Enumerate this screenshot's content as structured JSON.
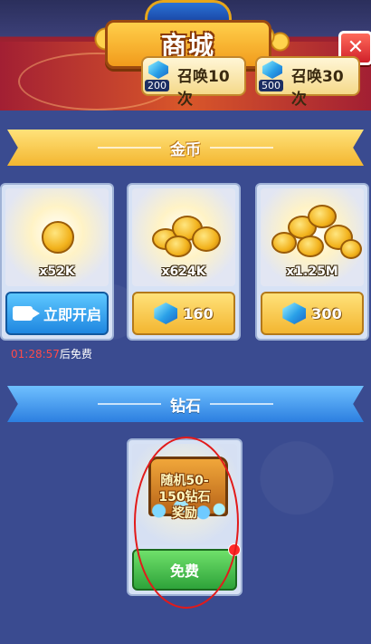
{
  "header": {
    "title": "商城",
    "close_icon": "close-x-icon",
    "summon_buttons": [
      {
        "label": "召唤10次",
        "cost": "200",
        "icon": "diamond-icon"
      },
      {
        "label": "召唤30次",
        "cost": "500",
        "icon": "diamond-icon"
      }
    ]
  },
  "sections": {
    "gold_title": "金币",
    "diamond_title": "钻石"
  },
  "gold_items": [
    {
      "amount": "x52K",
      "button": "立即开启",
      "button_icon": "video-icon",
      "type": "video"
    },
    {
      "amount": "x624K",
      "price": "160",
      "button_icon": "diamond-icon",
      "type": "price"
    },
    {
      "amount": "x1.25M",
      "price": "300",
      "button_icon": "diamond-icon",
      "type": "price"
    }
  ],
  "timer": {
    "time": "01:28:57",
    "suffix": "后免费"
  },
  "diamond_item": {
    "promo": "随机50-150钻石奖励",
    "promo_line1": "随机50-",
    "promo_line2": "150钻石",
    "promo_line3": "奖励",
    "button": "免费"
  },
  "colors": {
    "background": "#3b4c8f",
    "gold_ribbon": "#f3b630",
    "blue_ribbon": "#2c7fe0",
    "free_button": "#2ea33a",
    "close_button": "#d0202a",
    "annotation": "#e21a1a"
  }
}
